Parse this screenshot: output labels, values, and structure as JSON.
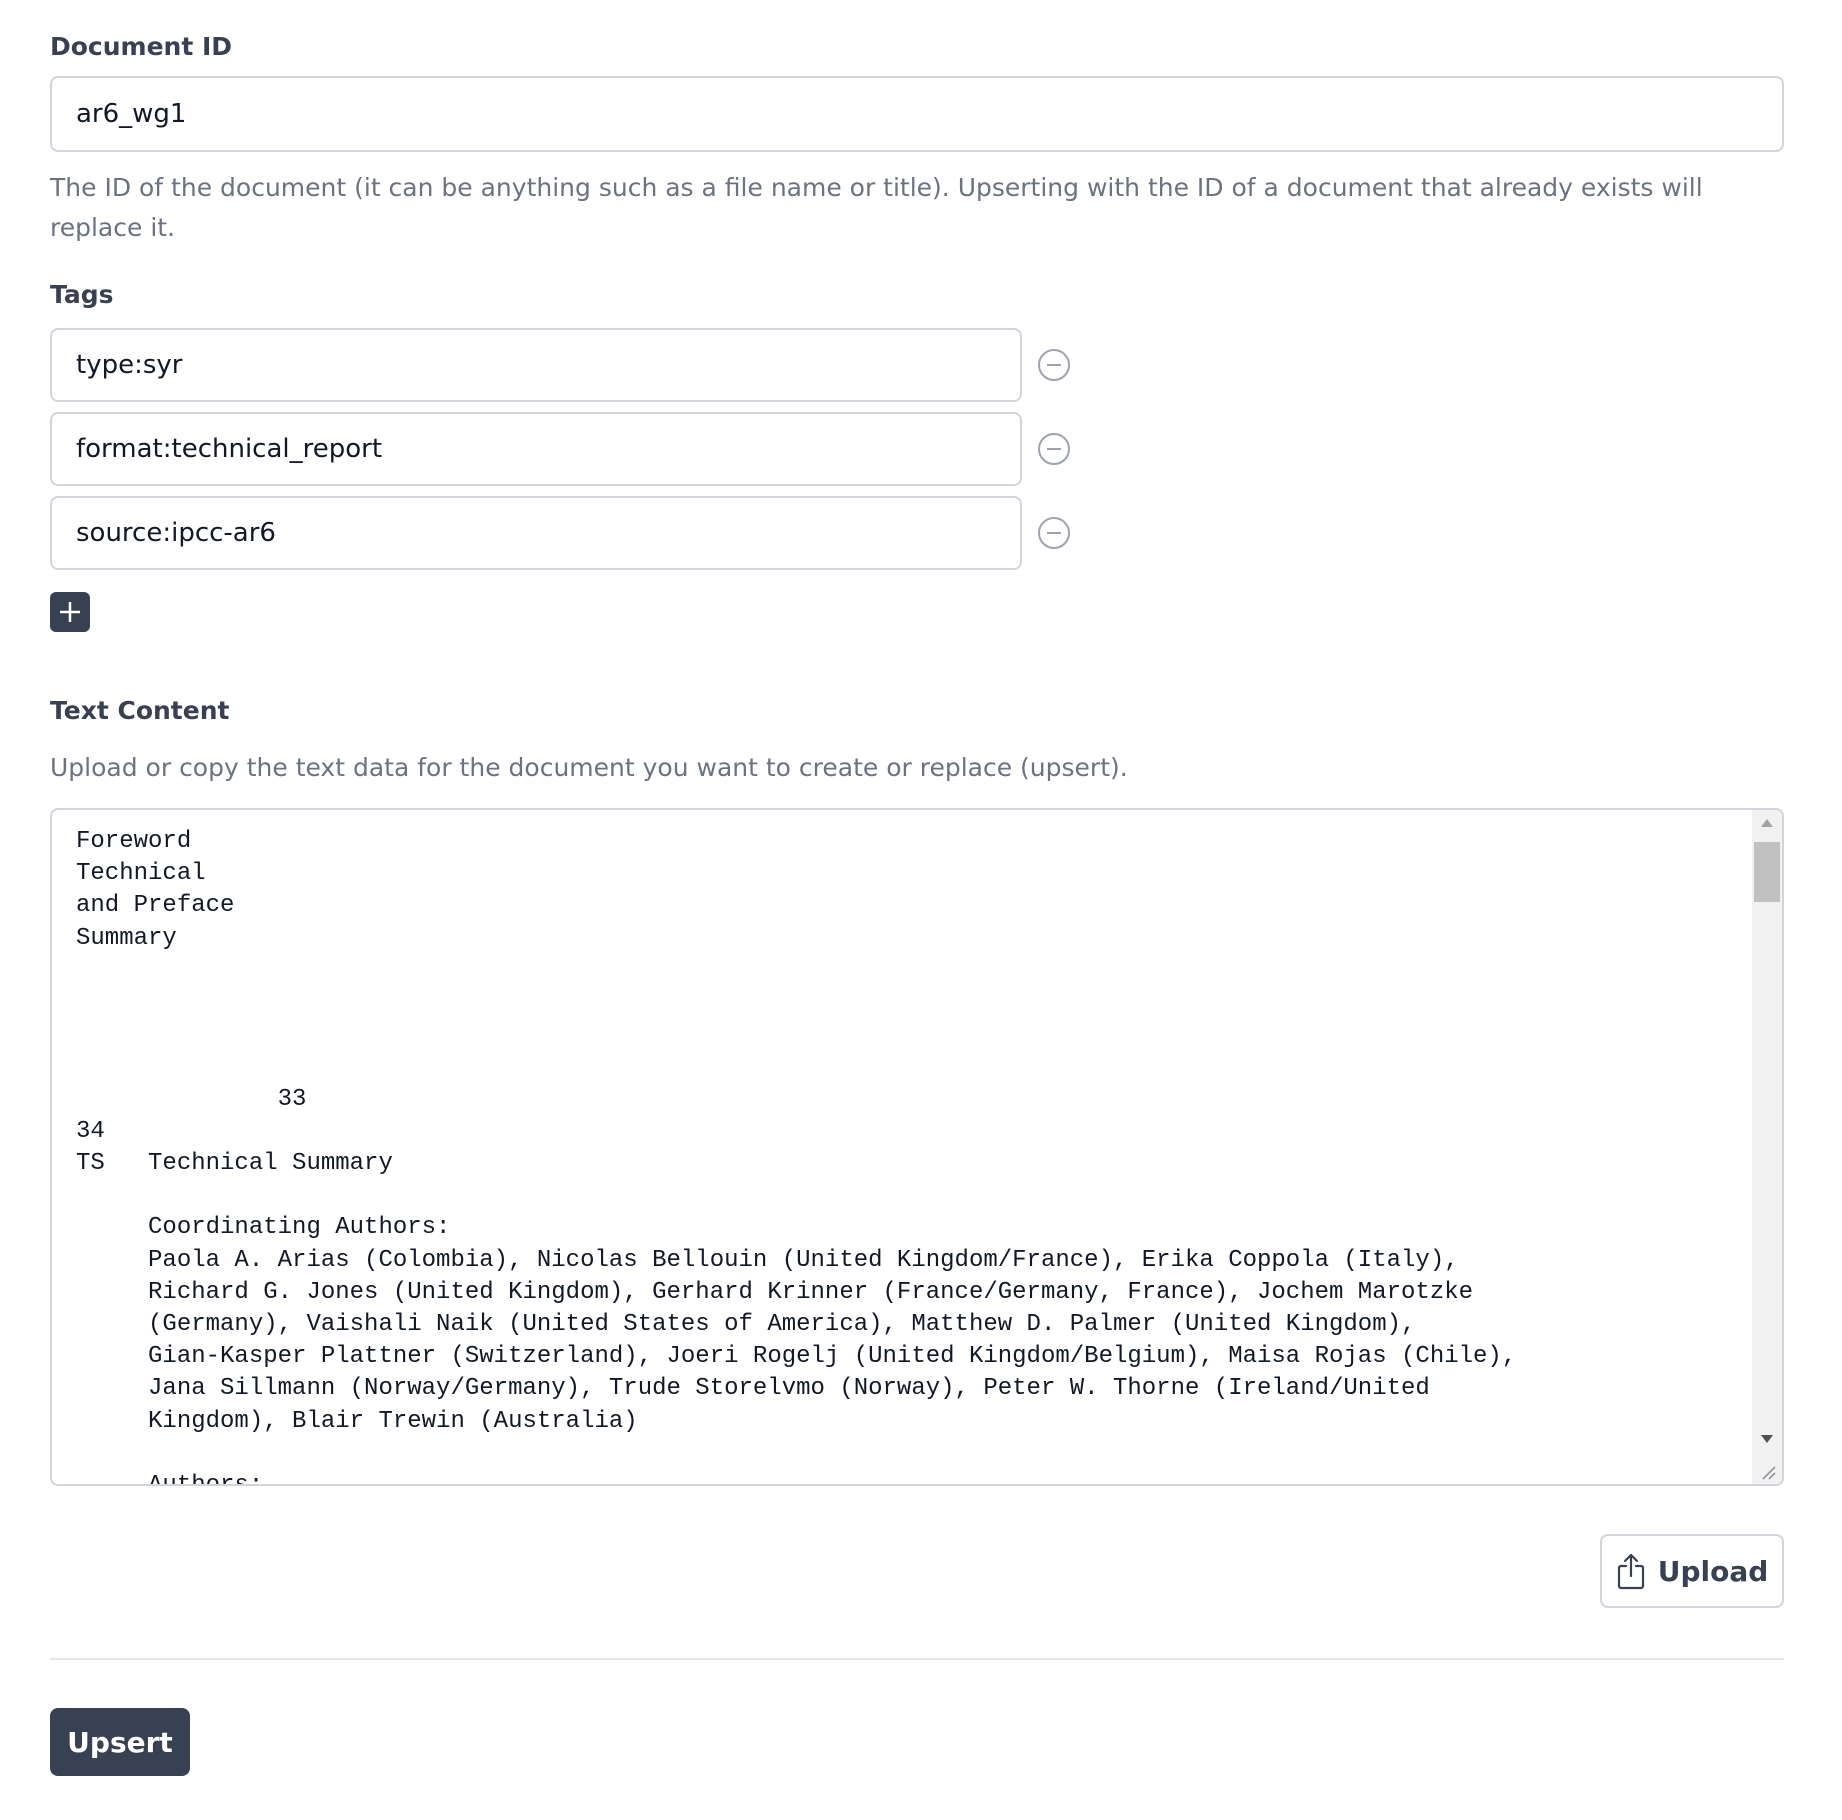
{
  "document_id": {
    "label": "Document ID",
    "value": "ar6_wg1",
    "help": "The ID of the document (it can be anything such as a file name or title). Upserting with the ID of a document that already exists will replace it."
  },
  "tags": {
    "label": "Tags",
    "items": [
      "type:syr",
      "format:technical_report",
      "source:ipcc-ar6"
    ],
    "remove_icon": "minus-circle-icon",
    "add_icon": "plus-icon"
  },
  "text_content": {
    "label": "Text Content",
    "help": "Upload or copy the text data for the document you want to create or replace (upsert).",
    "value": "Foreword\nTechnical\nand Preface\nSummary\n\n\n\n\n              33\n34\nTS   Technical Summary\n\n     Coordinating Authors:\n     Paola A. Arias (Colombia), Nicolas Bellouin (United Kingdom/France), Erika Coppola (Italy),\n     Richard G. Jones (United Kingdom), Gerhard Krinner (France/Germany, France), Jochem Marotzke\n     (Germany), Vaishali Naik (United States of America), Matthew D. Palmer (United Kingdom),\n     Gian-Kasper Plattner (Switzerland), Joeri Rogelj (United Kingdom/Belgium), Maisa Rojas (Chile),\n     Jana Sillmann (Norway/Germany), Trude Storelvmo (Norway), Peter W. Thorne (Ireland/United\n     Kingdom), Blair Trewin (Australia)\n\n     Authors:"
  },
  "upload_button": {
    "label": "Upload",
    "icon": "upload-share-icon"
  },
  "upsert_button": {
    "label": "Upsert"
  },
  "colors": {
    "primary_dark": "#374151",
    "border": "#d1d5db",
    "muted_text": "#6b7280"
  }
}
